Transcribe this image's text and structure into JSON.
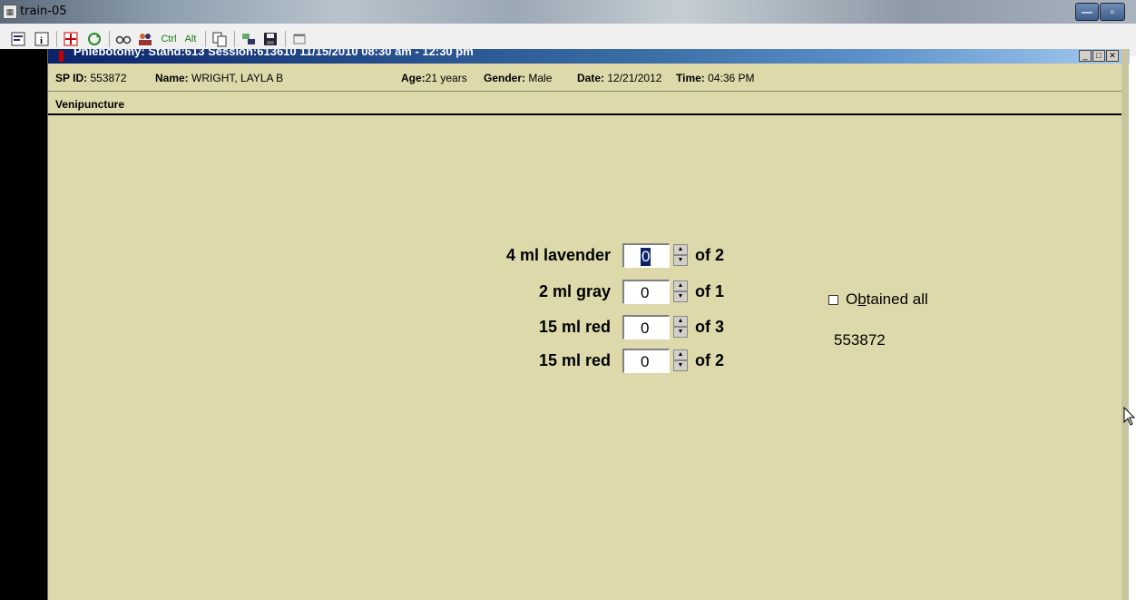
{
  "window": {
    "title": "train-05"
  },
  "toolbar": {
    "ctrl_label": "Ctrl",
    "alt_label": "Alt"
  },
  "inner_window": {
    "title": "Phlebotomy: Stand:613 Session:613610 11/15/2010 08:30 am - 12:30 pm"
  },
  "patient": {
    "sp_id_label": "SP ID:",
    "sp_id": "553872",
    "name_label": "Name:",
    "name": "WRIGHT, LAYLA B",
    "age_label": "Age:",
    "age": "21 years",
    "gender_label": "Gender:",
    "gender": "Male",
    "date_label": "Date:",
    "date": "12/21/2012",
    "time_label": "Time:",
    "time": "04:36 PM"
  },
  "section": {
    "title": "Venipuncture"
  },
  "tubes": [
    {
      "label": "4 ml lavender",
      "value": "0",
      "of": "of 2"
    },
    {
      "label": "2 ml gray",
      "value": "0",
      "of": "of 1"
    },
    {
      "label": "15 ml red",
      "value": "0",
      "of": "of 3"
    },
    {
      "label": "15 ml red",
      "value": "0",
      "of": "of 2"
    }
  ],
  "obtained_all": {
    "label_pre": "O",
    "label_underline": "b",
    "label_post": "tained all",
    "checked": false
  },
  "sp_number": "553872",
  "colors": {
    "panel_bg": "#ddd9ab",
    "title_blue": "#0a246a"
  }
}
